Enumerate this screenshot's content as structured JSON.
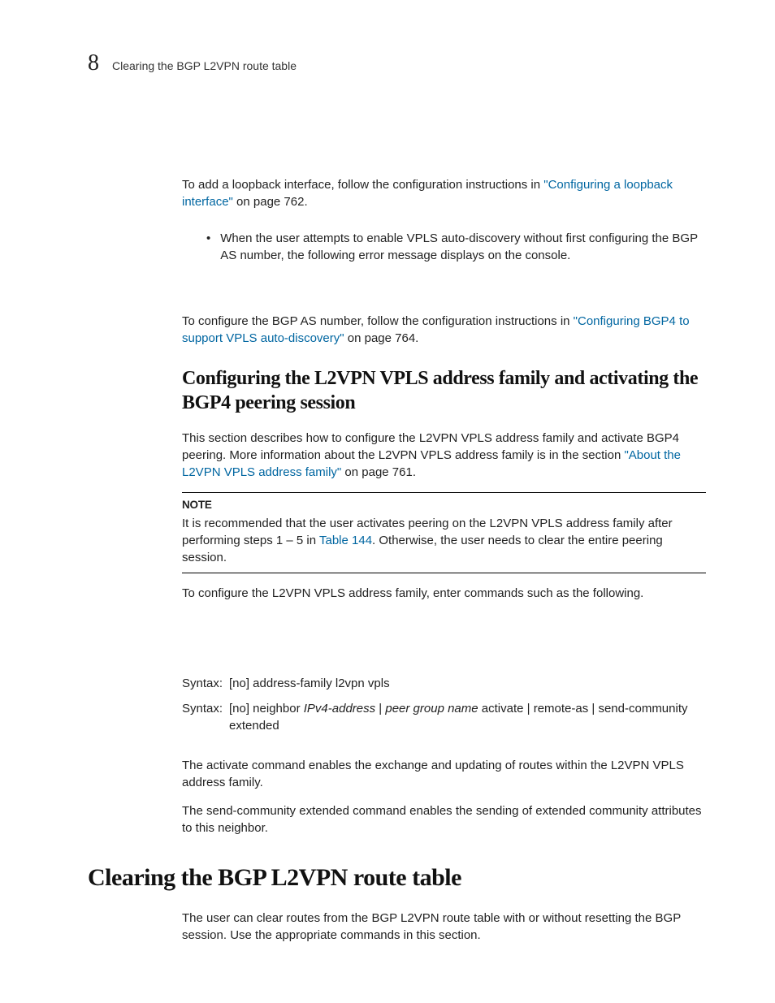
{
  "header": {
    "chapter_number": "8",
    "title": "Clearing the BGP L2VPN route table"
  },
  "intro": {
    "loopback_text_pre": "To add a loopback interface, follow the configuration instructions in ",
    "loopback_link": "\"Configuring a loopback interface\"",
    "loopback_text_post": " on page 762.",
    "bullet_text": "When the user attempts to enable VPLS auto-discovery without first configuring the BGP AS number, the following error message displays on the console.",
    "bgp_as_pre": "To configure the BGP AS number, follow the configuration instructions in ",
    "bgp_as_link": "\"Configuring BGP4 to support VPLS auto-discovery\"",
    "bgp_as_post": " on page 764."
  },
  "section_h2": "Configuring the L2VPN VPLS address family and activating the BGP4 peering session",
  "l2vpn": {
    "intro_pre": "This section describes how to configure the L2VPN VPLS address family and activate BGP4 peering. More information about the L2VPN VPLS address family is in the section ",
    "intro_link": "\"About the L2VPN VPLS address family\"",
    "intro_post": " on page 761.",
    "note_label": "NOTE",
    "note_pre": "It is recommended that the user activates peering on the L2VPN VPLS address family after performing steps 1 – 5 in ",
    "note_link": "Table 144",
    "note_post": ". Otherwise, the user needs to clear the entire peering session.",
    "config_cmd_intro": "To configure the L2VPN VPLS address family, enter commands such as the following.",
    "syntax_label": "Syntax:",
    "syntax1": "[no] address-family l2vpn vpls",
    "syntax2_a": "[no] neighbor ",
    "syntax2_b": "IPv4-address",
    "syntax2_c": " | ",
    "syntax2_d": "peer group name",
    "syntax2_e": " activate | remote-as | send-community extended",
    "activate_desc": "The activate command enables the exchange and updating of routes within the L2VPN VPLS address family.",
    "sendcomm_desc": "The send-community extended command enables the sending of extended community attributes to this neighbor."
  },
  "section_h1": "Clearing the BGP L2VPN route table",
  "clearing": {
    "intro": "The user can clear routes from the BGP L2VPN route table with or without resetting the BGP session. Use the appropriate commands in this section."
  }
}
